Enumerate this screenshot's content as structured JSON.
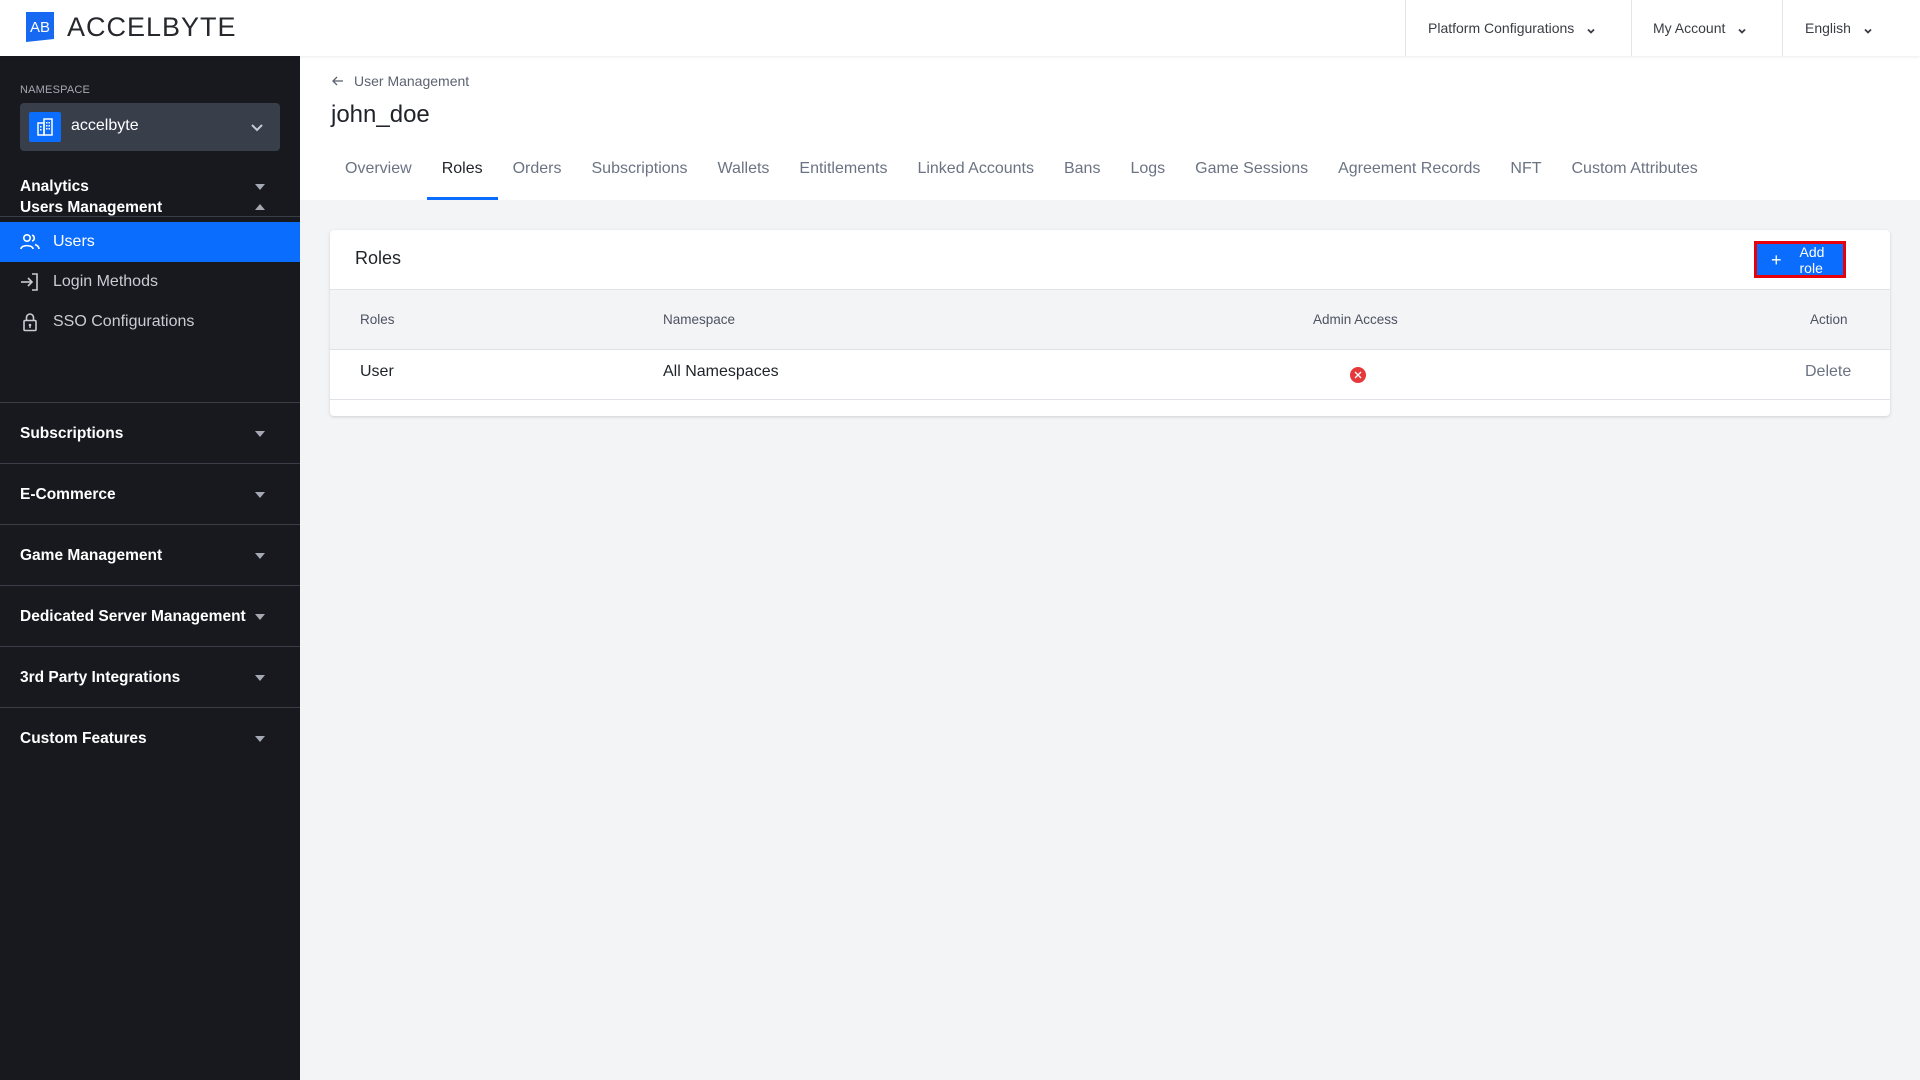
{
  "header": {
    "brand": "ACCELBYTE",
    "menus": [
      {
        "label": "Platform Configurations",
        "icon": "chevron-down-icon"
      },
      {
        "label": "My Account",
        "icon": "chevron-down-icon"
      },
      {
        "label": "English",
        "icon": "chevron-down-icon"
      }
    ]
  },
  "sidebar": {
    "namespace_label": "NAMESPACE",
    "namespace_value": "accelbyte",
    "sections": [
      {
        "label": "Analytics",
        "expanded": false
      },
      {
        "label": "Users Management",
        "expanded": true,
        "items": [
          {
            "label": "Users",
            "icon": "users-icon",
            "active": true
          },
          {
            "label": "Login Methods",
            "icon": "login-icon",
            "active": false
          },
          {
            "label": "SSO Configurations",
            "icon": "lock-icon",
            "active": false
          }
        ]
      },
      {
        "label": "Subscriptions",
        "expanded": false
      },
      {
        "label": "E-Commerce",
        "expanded": false
      },
      {
        "label": "Game Management",
        "expanded": false
      },
      {
        "label": "Dedicated Server Management",
        "expanded": false
      },
      {
        "label": "3rd Party Integrations",
        "expanded": false
      },
      {
        "label": "Custom Features",
        "expanded": false
      }
    ]
  },
  "page": {
    "breadcrumb": "User Management",
    "title": "john_doe",
    "tabs": [
      {
        "label": "Overview"
      },
      {
        "label": "Roles",
        "active": true
      },
      {
        "label": "Orders"
      },
      {
        "label": "Subscriptions"
      },
      {
        "label": "Wallets"
      },
      {
        "label": "Entitlements"
      },
      {
        "label": "Linked Accounts"
      },
      {
        "label": "Bans"
      },
      {
        "label": "Logs"
      },
      {
        "label": "Game Sessions"
      },
      {
        "label": "Agreement Records"
      },
      {
        "label": "NFT"
      },
      {
        "label": "Custom Attributes"
      }
    ]
  },
  "roles_card": {
    "title": "Roles",
    "add_button": "Add role",
    "columns": [
      "Roles",
      "Namespace",
      "Admin Access",
      "Action"
    ],
    "rows": [
      {
        "role": "User",
        "namespace": "All Namespaces",
        "admin_access": false,
        "action": "Delete"
      }
    ]
  },
  "colors": {
    "accent": "#0b6dfe",
    "sidebar_bg": "#17191e",
    "danger": "#e5383b",
    "highlight_border": "#e8000b"
  }
}
